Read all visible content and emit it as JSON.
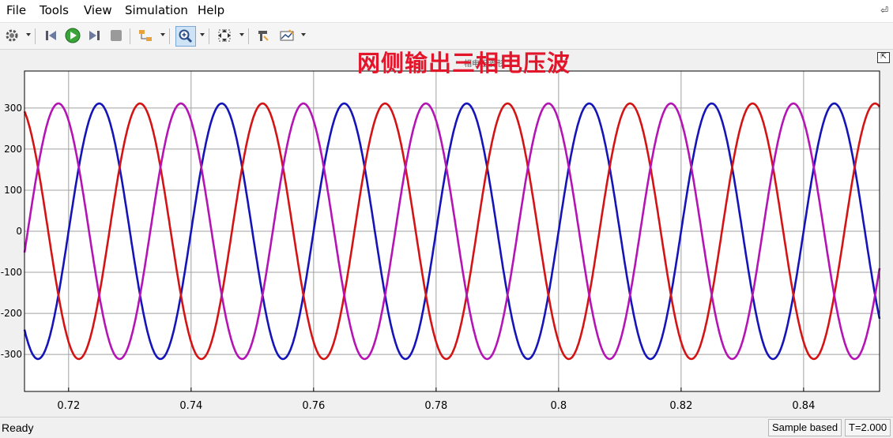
{
  "menu": {
    "items": [
      "File",
      "Tools",
      "View",
      "Simulation",
      "Help"
    ],
    "pin": "⏎"
  },
  "toolbar": {
    "icons": [
      "gear-icon",
      "step-back-icon",
      "run-icon",
      "step-forward-icon",
      "stop-icon",
      "block-diagram-icon",
      "zoom-in-icon",
      "fit-to-view-icon",
      "style-icon",
      "signal-edit-icon"
    ]
  },
  "overlay_title": "网侧输出三相电压波",
  "plot_title_fragment": "相电压波形",
  "status": {
    "ready": "Ready",
    "mode": "Sample based",
    "time": "T=2.000"
  },
  "chart_data": {
    "type": "line",
    "title": "网侧输出三相电压波",
    "xlabel": "",
    "ylabel": "",
    "xlim": [
      0.7128,
      0.8524
    ],
    "ylim": [
      -390,
      390
    ],
    "xticks": [
      0.72,
      0.74,
      0.76,
      0.78,
      0.8,
      0.82,
      0.84
    ],
    "xtick_labels": [
      "0.72",
      "0.74",
      "0.76",
      "0.78",
      "0.8",
      "0.82",
      "0.84"
    ],
    "yticks": [
      300,
      200,
      100,
      0,
      -100,
      -200,
      -300
    ],
    "ytick_labels": [
      "300",
      "200",
      "100",
      "0",
      "-100",
      "-200",
      "-300"
    ],
    "grid": true,
    "frequency_hz": 50,
    "series": [
      {
        "amplitude": 311,
        "phase_deg": 0,
        "color": "#1414b8"
      },
      {
        "amplitude": 311,
        "phase_deg": -120,
        "color": "#d41414"
      },
      {
        "amplitude": 311,
        "phase_deg": 120,
        "color": "#b414b4"
      }
    ]
  }
}
